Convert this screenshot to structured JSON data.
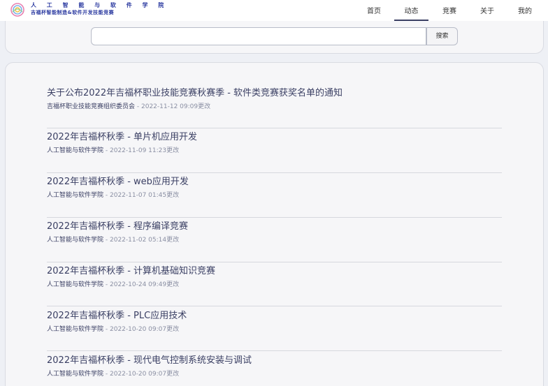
{
  "brand": {
    "line1": "人 工 智 能 与 软 件 学 院",
    "line2": "吉福杯智能制造&软件开发技能竞赛"
  },
  "nav": [
    {
      "label": "首页",
      "active": false
    },
    {
      "label": "动态",
      "active": true
    },
    {
      "label": "竞赛",
      "active": false
    },
    {
      "label": "关于",
      "active": false
    },
    {
      "label": "我的",
      "active": false
    }
  ],
  "search": {
    "value": "",
    "placeholder": "",
    "button_label": "搜索"
  },
  "articles": [
    {
      "title": "关于公布2022年吉福杯职业技能竞赛秋赛季 - 软件类竞赛获奖名单的通知",
      "org": "吉福杯职业技能竞赛组织委员会",
      "sep": " - ",
      "time": "2022-11-12 09:09更改"
    },
    {
      "title": "2022年吉福杯秋季 - 单片机应用开发",
      "org": "人工智能与软件学院",
      "sep": " - ",
      "time": "2022-11-09 11:23更改"
    },
    {
      "title": "2022年吉福杯秋季 - web应用开发",
      "org": "人工智能与软件学院",
      "sep": " - ",
      "time": "2022-11-07 01:45更改"
    },
    {
      "title": "2022年吉福杯秋季 - 程序编译竞赛",
      "org": "人工智能与软件学院",
      "sep": " - ",
      "time": "2022-11-02 05:14更改"
    },
    {
      "title": "2022年吉福杯秋季 - 计算机基础知识竞赛",
      "org": "人工智能与软件学院",
      "sep": " - ",
      "time": "2022-10-24 09:49更改"
    },
    {
      "title": "2022年吉福杯秋季 - PLC应用技术",
      "org": "人工智能与软件学院",
      "sep": " - ",
      "time": "2022-10-20 09:07更改"
    },
    {
      "title": "2022年吉福杯秋季 - 现代电气控制系统安装与调试",
      "org": "人工智能与软件学院",
      "sep": " - ",
      "time": "2022-10-20 09:07更改"
    }
  ],
  "colors": {
    "accent": "#3a3f63",
    "brand": "#2b3aa0",
    "muted": "#8a8fa3",
    "background": "#eef0f5"
  },
  "icons": {
    "logo": "college-logo-icon"
  }
}
